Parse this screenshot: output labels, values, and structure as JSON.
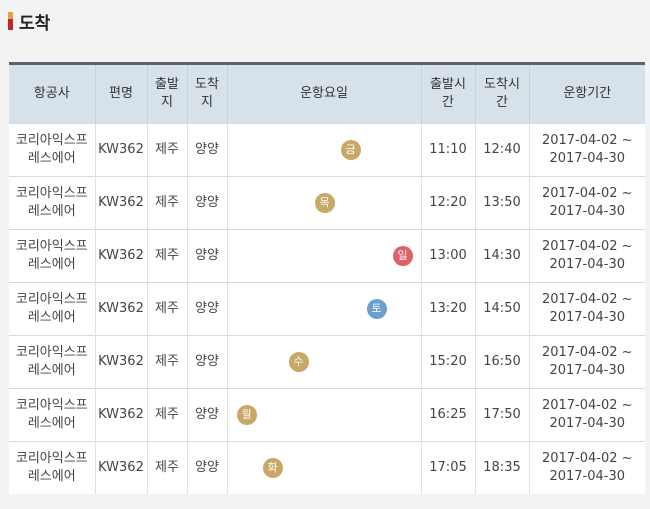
{
  "section": {
    "title": "도착"
  },
  "columns": {
    "airline": "항공사",
    "flight": "편명",
    "depart_line1": "출발",
    "depart_line2": "지",
    "arrive_line1": "도착",
    "arrive_line2": "지",
    "weekday": "운항요일",
    "dep_time_line1": "출발시",
    "dep_time_line2": "간",
    "arr_time_line1": "도착시",
    "arr_time_line2": "간",
    "period": "운항기간"
  },
  "rows": [
    {
      "airline_line1": "코리아익스프",
      "airline_line2": "레스에어",
      "flight": "KW362",
      "from": "제주",
      "to": "양양",
      "day": "금",
      "day_index": 5,
      "day_color": "#c9a766",
      "dep": "11:10",
      "arr": "12:40",
      "period_start": "2017-04-02 ~",
      "period_end": "2017-04-30"
    },
    {
      "airline_line1": "코리아익스프",
      "airline_line2": "레스에어",
      "flight": "KW362",
      "from": "제주",
      "to": "양양",
      "day": "목",
      "day_index": 4,
      "day_color": "#c9a766",
      "dep": "12:20",
      "arr": "13:50",
      "period_start": "2017-04-02 ~",
      "period_end": "2017-04-30"
    },
    {
      "airline_line1": "코리아익스프",
      "airline_line2": "레스에어",
      "flight": "KW362",
      "from": "제주",
      "to": "양양",
      "day": "일",
      "day_index": 7,
      "day_color": "#e06068",
      "dep": "13:00",
      "arr": "14:30",
      "period_start": "2017-04-02 ~",
      "period_end": "2017-04-30"
    },
    {
      "airline_line1": "코리아익스프",
      "airline_line2": "레스에어",
      "flight": "KW362",
      "from": "제주",
      "to": "양양",
      "day": "토",
      "day_index": 6,
      "day_color": "#6a9fce",
      "dep": "13:20",
      "arr": "14:50",
      "period_start": "2017-04-02 ~",
      "period_end": "2017-04-30"
    },
    {
      "airline_line1": "코리아익스프",
      "airline_line2": "레스에어",
      "flight": "KW362",
      "from": "제주",
      "to": "양양",
      "day": "수",
      "day_index": 3,
      "day_color": "#c9a766",
      "dep": "15:20",
      "arr": "16:50",
      "period_start": "2017-04-02 ~",
      "period_end": "2017-04-30"
    },
    {
      "airline_line1": "코리아익스프",
      "airline_line2": "레스에어",
      "flight": "KW362",
      "from": "제주",
      "to": "양양",
      "day": "월",
      "day_index": 1,
      "day_color": "#c9a766",
      "dep": "16:25",
      "arr": "17:50",
      "period_start": "2017-04-02 ~",
      "period_end": "2017-04-30"
    },
    {
      "airline_line1": "코리아익스프",
      "airline_line2": "레스에어",
      "flight": "KW362",
      "from": "제주",
      "to": "양양",
      "day": "화",
      "day_index": 2,
      "day_color": "#c9a766",
      "dep": "17:05",
      "arr": "18:35",
      "period_start": "2017-04-02 ~",
      "period_end": "2017-04-30"
    }
  ]
}
